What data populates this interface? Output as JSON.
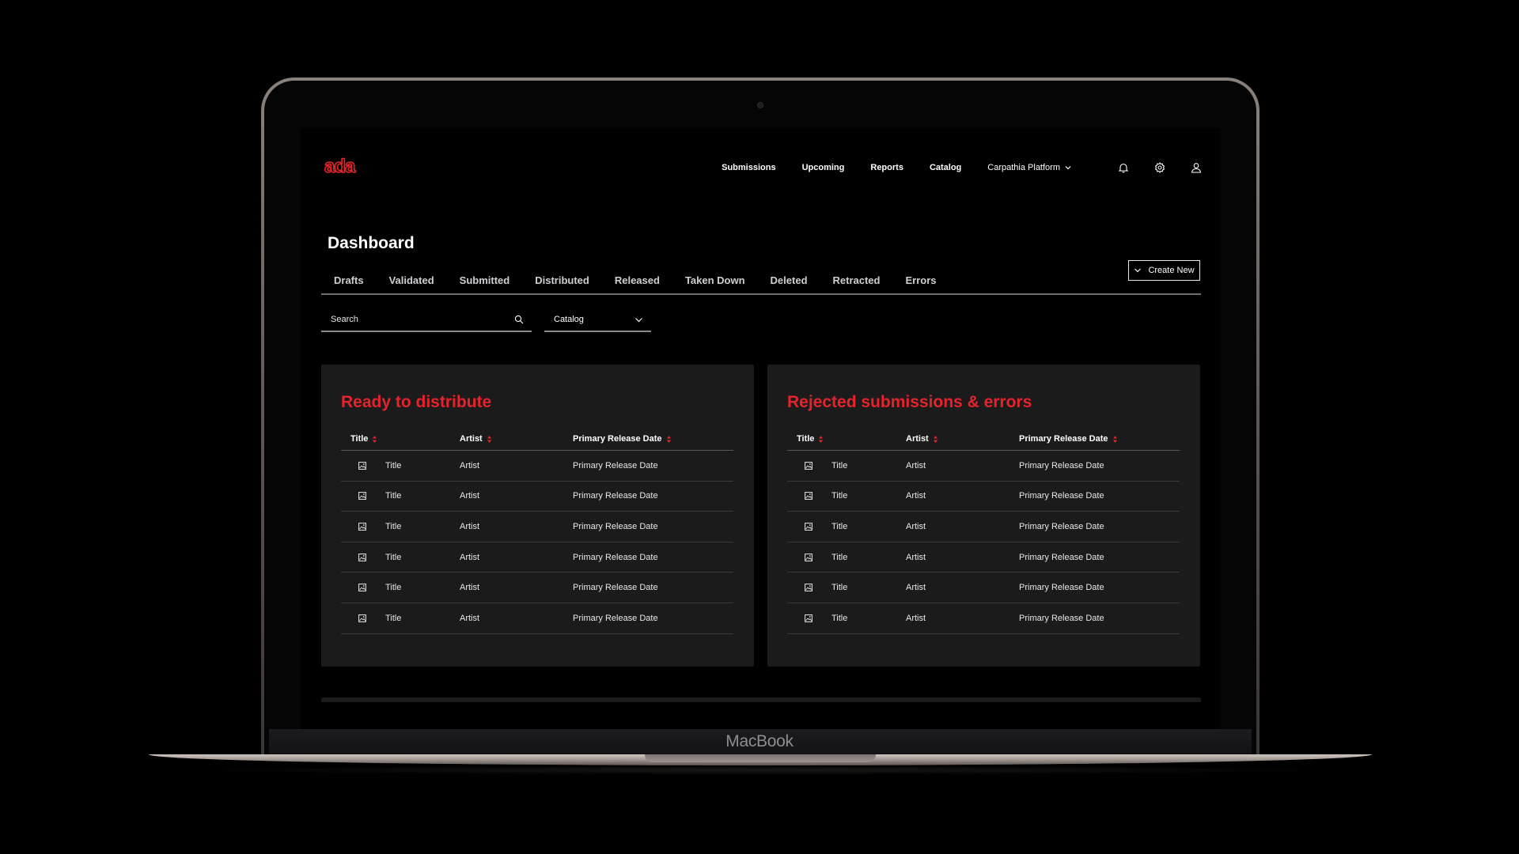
{
  "device": {
    "brand_label": "MacBook"
  },
  "app": {
    "logo_text": "ada",
    "accent_color": "#e5232c"
  },
  "nav": {
    "items": [
      "Submissions",
      "Upcoming",
      "Reports",
      "Catalog"
    ],
    "platform_label": "Carpathia Platform",
    "icons": [
      "bell-icon",
      "gear-icon",
      "user-icon"
    ]
  },
  "page": {
    "title": "Dashboard"
  },
  "tabs": [
    "Drafts",
    "Validated",
    "Submitted",
    "Distributed",
    "Released",
    "Taken Down",
    "Deleted",
    "Retracted",
    "Errors"
  ],
  "toolbar": {
    "create_label": "Create New",
    "search_placeholder": "Search",
    "select_value": "Catalog"
  },
  "panels": [
    {
      "title": "Ready to distribute",
      "columns": [
        "Title",
        "Artist",
        "Primary Release Date"
      ],
      "rows": [
        [
          "Title",
          "Artist",
          "Primary Release Date"
        ],
        [
          "Title",
          "Artist",
          "Primary Release Date"
        ],
        [
          "Title",
          "Artist",
          "Primary Release Date"
        ],
        [
          "Title",
          "Artist",
          "Primary Release Date"
        ],
        [
          "Title",
          "Artist",
          "Primary Release Date"
        ],
        [
          "Title",
          "Artist",
          "Primary Release Date"
        ]
      ]
    },
    {
      "title": "Rejected submissions & errors",
      "columns": [
        "Title",
        "Artist",
        "Primary Release Date"
      ],
      "rows": [
        [
          "Title",
          "Artist",
          "Primary Release Date"
        ],
        [
          "Title",
          "Artist",
          "Primary Release Date"
        ],
        [
          "Title",
          "Artist",
          "Primary Release Date"
        ],
        [
          "Title",
          "Artist",
          "Primary Release Date"
        ],
        [
          "Title",
          "Artist",
          "Primary Release Date"
        ],
        [
          "Title",
          "Artist",
          "Primary Release Date"
        ]
      ]
    }
  ]
}
